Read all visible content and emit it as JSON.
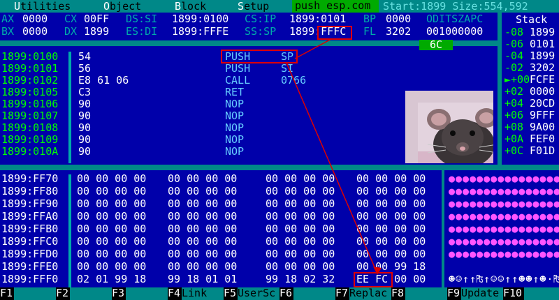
{
  "menu": {
    "items": [
      {
        "hot": "U",
        "rest": "tilities"
      },
      {
        "hot": "O",
        "rest": "bject"
      },
      {
        "hot": "B",
        "rest": "lock"
      },
      {
        "hot": "S",
        "rest": "etup"
      }
    ],
    "program": "push esp.com",
    "mem_info": "Start:1899 Size:554,592"
  },
  "registers": {
    "row1": [
      {
        "name": "AX",
        "value": "0000"
      },
      {
        "name": "CX",
        "value": "00FF"
      },
      {
        "name": "DS:SI",
        "value": "1899:0100"
      },
      {
        "name": "CS:IP",
        "value": "1899:0101"
      },
      {
        "name": "BP",
        "value": "0000"
      }
    ],
    "row2": [
      {
        "name": "BX",
        "value": "0000"
      },
      {
        "name": "DX",
        "value": "1899"
      },
      {
        "name": "ES:DI",
        "value": "1899:FFFE"
      },
      {
        "name": "SS:SP",
        "value": "1899:FFFC"
      },
      {
        "name": "FL",
        "value": "3202"
      }
    ],
    "flags_label": "ODITSZAPC",
    "flags_value": "001000000",
    "badge": "6C"
  },
  "stack": {
    "title": "Stack",
    "rows": [
      {
        "off": "-08",
        "val": "1899"
      },
      {
        "off": "-06",
        "val": "0101"
      },
      {
        "off": "-04",
        "val": "1899"
      },
      {
        "off": "-02",
        "val": "3202"
      },
      {
        "off": "►+00",
        "val": "FCFE"
      },
      {
        "off": "+02",
        "val": "0000"
      },
      {
        "off": "+04",
        "val": "20CD"
      },
      {
        "off": "+06",
        "val": "9FFF"
      },
      {
        "off": "+08",
        "val": "9A00"
      },
      {
        "off": "+0A",
        "val": "FEF0"
      },
      {
        "off": "+0C",
        "val": "F01D"
      }
    ]
  },
  "code": [
    {
      "addr": "1899:0100",
      "bytes": "54",
      "mn": "PUSH",
      "op": "SP"
    },
    {
      "addr": "1899:0101",
      "bytes": "56",
      "mn": "PUSH",
      "op": "SI"
    },
    {
      "addr": "1899:0102",
      "bytes": "E8 61 06",
      "mn": "CALL",
      "op": "0766"
    },
    {
      "addr": "1899:0105",
      "bytes": "C3",
      "mn": "RET",
      "op": ""
    },
    {
      "addr": "1899:0106",
      "bytes": "90",
      "mn": "NOP",
      "op": ""
    },
    {
      "addr": "1899:0107",
      "bytes": "90",
      "mn": "NOP",
      "op": ""
    },
    {
      "addr": "1899:0108",
      "bytes": "90",
      "mn": "NOP",
      "op": ""
    },
    {
      "addr": "1899:0109",
      "bytes": "90",
      "mn": "NOP",
      "op": ""
    },
    {
      "addr": "1899:010A",
      "bytes": "90",
      "mn": "NOP",
      "op": ""
    }
  ],
  "dump": [
    {
      "addr": "1899:FF70",
      "groups": [
        "00 00 00 00",
        "00 00 00 00",
        "00 00 00 00",
        "00 00 00 00"
      ]
    },
    {
      "addr": "1899:FF80",
      "groups": [
        "00 00 00 00",
        "00 00 00 00",
        "00 00 00 00",
        "00 00 00 00"
      ]
    },
    {
      "addr": "1899:FF90",
      "groups": [
        "00 00 00 00",
        "00 00 00 00",
        "00 00 00 00",
        "00 00 00 00"
      ]
    },
    {
      "addr": "1899:FFA0",
      "groups": [
        "00 00 00 00",
        "00 00 00 00",
        "00 00 00 00",
        "00 00 00 00"
      ]
    },
    {
      "addr": "1899:FFB0",
      "groups": [
        "00 00 00 00",
        "00 00 00 00",
        "00 00 00 00",
        "00 00 00 00"
      ]
    },
    {
      "addr": "1899:FFC0",
      "groups": [
        "00 00 00 00",
        "00 00 00 00",
        "00 00 00 00",
        "00 00 00 00"
      ]
    },
    {
      "addr": "1899:FFD0",
      "groups": [
        "00 00 00 00",
        "00 00 00 00",
        "00 00 00 00",
        "00 00 00 00"
      ]
    },
    {
      "addr": "1899:FFE0",
      "groups": [
        "00 00 00 00",
        "00 00 00 00",
        "00 00 00 00",
        "00 00 99 18"
      ]
    },
    {
      "addr": "1899:FFF0",
      "groups": [
        "02 01 99 18",
        "99 18 01 01",
        "99 18 02 32",
        "EE FC 00 00"
      ]
    }
  ],
  "ascii": [
    "●●●●●●●●●●●●●●●●",
    "●●●●●●●●●●●●●●●●",
    "●●●●●●●●●●●●●●●●",
    "●●●●●●●●●●●●●●●●",
    "●●●●●●●●●●●●●●●●",
    "●●●●●●●●●●●●●●●●",
    "●●●●●●●●●●●●●●●●",
    "                ₧↑",
    "☻☺↑↑₧↑☺☺↑↑☻☻↑☻·₧"
  ],
  "fkeys": [
    {
      "num": "F1",
      "label": ""
    },
    {
      "num": "F2",
      "label": ""
    },
    {
      "num": "F3",
      "label": ""
    },
    {
      "num": "F4",
      "label": "Link"
    },
    {
      "num": "F5",
      "label": "UserSc"
    },
    {
      "num": "F6",
      "label": ""
    },
    {
      "num": "F7",
      "label": "Replac"
    },
    {
      "num": "F8",
      "label": ""
    },
    {
      "num": "F9",
      "label": "Update"
    },
    {
      "num": "F10",
      "label": ""
    }
  ],
  "colors": {
    "panel": "#0000aa",
    "frame": "#008888",
    "address": "#00ff00",
    "mnemonic": "#66ccff",
    "highlight": "#dd0000"
  }
}
